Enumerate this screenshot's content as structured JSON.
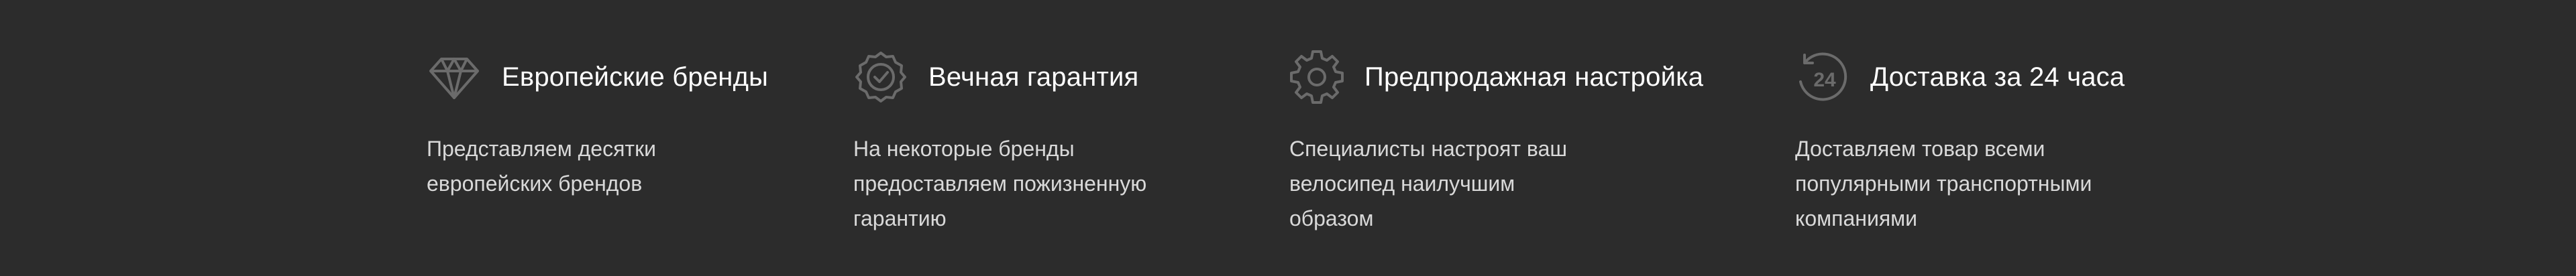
{
  "features": [
    {
      "icon": "diamond-icon",
      "title": "Европейские бренды",
      "text": "Представляем десятки\nевропейских брендов"
    },
    {
      "icon": "guarantee-badge-icon",
      "title": "Вечная гарантия",
      "text": "На некоторые бренды\nпредоставляем пожизненную\nгарантию"
    },
    {
      "icon": "gear-icon",
      "title": "Предпродажная настройка",
      "text": "Специалисты настроят ваш\nвелосипед наилучшим\nобразом"
    },
    {
      "icon": "delivery-24-icon",
      "icon_label": "24",
      "title": "Доставка за 24 часа",
      "text": "Доставляем товар всеми\nпопулярными транспортными\nкомпаниями"
    }
  ],
  "colors": {
    "background": "#2c2c2c",
    "title": "#ffffff",
    "text": "#d9d9d9",
    "icon": "#6b6b6b"
  }
}
